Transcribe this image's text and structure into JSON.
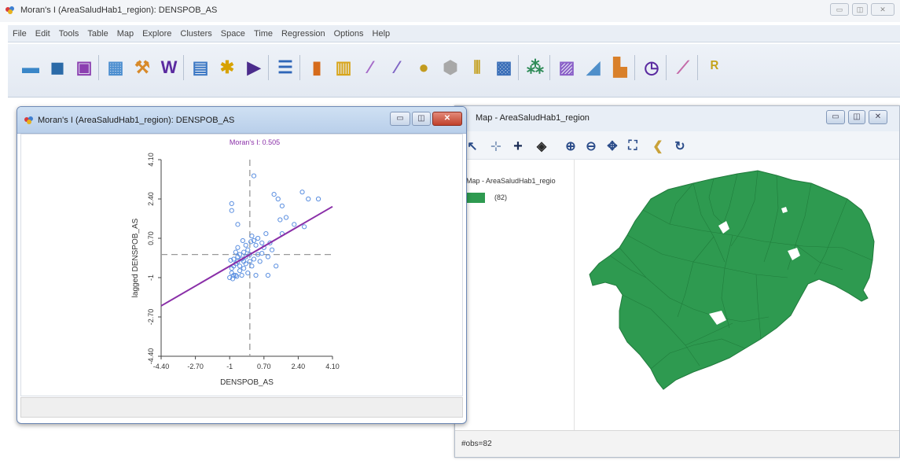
{
  "app": {
    "title": "Moran's I (AreaSaludHab1_region): DENSPOB_AS",
    "menu": [
      "File",
      "Edit",
      "Tools",
      "Table",
      "Map",
      "Explore",
      "Clusters",
      "Space",
      "Time",
      "Regression",
      "Options",
      "Help"
    ]
  },
  "toolbar_icons": [
    {
      "name": "open-project-icon",
      "color": "#3a86c8",
      "glyph": "▬"
    },
    {
      "name": "close-project-icon",
      "color": "#2b6aa8",
      "glyph": "◼"
    },
    {
      "name": "save-project-icon",
      "color": "#8b3fb0",
      "glyph": "▣"
    },
    {
      "name": "table-icon",
      "color": "#4d8fd0",
      "glyph": "▦"
    },
    {
      "name": "tools-icon",
      "color": "#d88a2a",
      "glyph": "⚒"
    },
    {
      "name": "weights-icon",
      "color": "#5a2aa0",
      "glyph": "W"
    },
    {
      "name": "shape-icon",
      "color": "#3c78c4",
      "glyph": "▤"
    },
    {
      "name": "connectivity-icon",
      "color": "#d7a200",
      "glyph": "✱"
    },
    {
      "name": "play-icon",
      "color": "#4b2c8c",
      "glyph": "▶"
    },
    {
      "name": "category-editor-icon",
      "color": "#2f66b8",
      "glyph": "☰"
    },
    {
      "name": "histogram-icon",
      "color": "#d66b1c",
      "glyph": "▮"
    },
    {
      "name": "box-plot-icon",
      "color": "#d8a51b",
      "glyph": "▥"
    },
    {
      "name": "scatter-plot-icon",
      "color": "#a569c8",
      "glyph": "⁄"
    },
    {
      "name": "scatter-matrix-icon",
      "color": "#7e64c4",
      "glyph": "⁄"
    },
    {
      "name": "bubble-chart-icon",
      "color": "#c29b1f",
      "glyph": "●"
    },
    {
      "name": "3d-plot-icon",
      "color": "#a8a8a8",
      "glyph": "⬢"
    },
    {
      "name": "parallel-coords-icon",
      "color": "#c6a42a",
      "glyph": "⫴"
    },
    {
      "name": "conditional-plot-icon",
      "color": "#3b6fb8",
      "glyph": "▩"
    },
    {
      "name": "cluster-icon",
      "color": "#2e8b57",
      "glyph": "⁂"
    },
    {
      "name": "moran-scatter-icon",
      "color": "#8a5fc8",
      "glyph": "▨"
    },
    {
      "name": "lisa-icon",
      "color": "#4f8fca",
      "glyph": "◢"
    },
    {
      "name": "cartogram-icon",
      "color": "#d9802a",
      "glyph": "▙"
    },
    {
      "name": "time-icon",
      "color": "#5a2aa0",
      "glyph": "◷"
    },
    {
      "name": "averages-chart-icon",
      "color": "#c46aa8",
      "glyph": "⟋"
    },
    {
      "name": "regression-icon",
      "color": "#c4a31a",
      "glyph": "ᴿ"
    }
  ],
  "map_window": {
    "title": "Map - AreaSaludHab1_region",
    "legend_title": "Map - AreaSaludHab1_regio",
    "legend_count": "(82)",
    "legend_color": "#2e9a50",
    "status": "#obs=82",
    "controls": [
      "▭",
      "◫",
      "✕"
    ]
  },
  "moran_window": {
    "title": "Moran's I (AreaSaludHab1_region): DENSPOB_AS",
    "controls": [
      "▭",
      "◫",
      "✕"
    ]
  },
  "chart_data": {
    "type": "scatter",
    "title": "Moran's I: 0.505",
    "xlabel": "DENSPOB_AS",
    "ylabel": "lagged DENSPOB_AS",
    "xlim": [
      -4.4,
      4.1
    ],
    "ylim": [
      -4.4,
      4.1
    ],
    "xticks": [
      "-4.40",
      "-2.70",
      "-1",
      "0.70",
      "2.40",
      "4.10"
    ],
    "yticks": [
      "-4.40",
      "-2.70",
      "-1",
      "0.70",
      "2.40",
      "4.10"
    ],
    "regression": {
      "slope": 0.505,
      "intercept": 0.0,
      "color": "#8a2fa8"
    },
    "point_color": "#5b8fe0",
    "points": [
      [
        -0.9,
        -0.8
      ],
      [
        -0.8,
        -0.5
      ],
      [
        -0.7,
        -0.9
      ],
      [
        -0.6,
        -0.3
      ],
      [
        -0.5,
        -0.7
      ],
      [
        -0.4,
        -0.2
      ],
      [
        -0.3,
        -0.6
      ],
      [
        -0.2,
        -0.4
      ],
      [
        -0.1,
        -0.8
      ],
      [
        0.0,
        -0.3
      ],
      [
        -0.8,
        -0.2
      ],
      [
        -0.7,
        -0.4
      ],
      [
        -0.6,
        -0.1
      ],
      [
        -0.5,
        -0.5
      ],
      [
        -0.4,
        -0.9
      ],
      [
        -0.3,
        0.1
      ],
      [
        -0.2,
        -0.1
      ],
      [
        -0.1,
        0.2
      ],
      [
        0.0,
        0.0
      ],
      [
        0.1,
        -0.5
      ],
      [
        -0.9,
        -0.6
      ],
      [
        -0.8,
        -0.9
      ],
      [
        -0.5,
        0.0
      ],
      [
        -0.3,
        -0.3
      ],
      [
        0.2,
        -0.2
      ],
      [
        0.3,
        0.4
      ],
      [
        0.4,
        0.0
      ],
      [
        0.5,
        -0.3
      ],
      [
        0.6,
        0.5
      ],
      [
        0.7,
        0.3
      ],
      [
        0.2,
        0.6
      ],
      [
        0.1,
        0.8
      ],
      [
        0.4,
        0.7
      ],
      [
        -0.6,
        0.3
      ],
      [
        -0.7,
        0.1
      ],
      [
        -0.2,
        0.4
      ],
      [
        0.9,
        -0.1
      ],
      [
        1.1,
        0.2
      ],
      [
        1.3,
        -0.5
      ],
      [
        0.8,
        0.9
      ],
      [
        -0.9,
        1.9
      ],
      [
        -0.9,
        2.2
      ],
      [
        -0.6,
        1.3
      ],
      [
        0.2,
        3.4
      ],
      [
        1.2,
        2.6
      ],
      [
        1.4,
        2.4
      ],
      [
        1.6,
        2.1
      ],
      [
        1.8,
        1.6
      ],
      [
        2.2,
        1.3
      ],
      [
        1.6,
        0.9
      ],
      [
        2.6,
        2.7
      ],
      [
        2.9,
        2.4
      ],
      [
        3.4,
        2.4
      ],
      [
        2.7,
        1.2
      ],
      [
        1.5,
        1.5
      ],
      [
        -1.0,
        -1.0
      ],
      [
        -0.85,
        -1.05
      ],
      [
        -0.65,
        -0.95
      ],
      [
        0.3,
        -0.9
      ],
      [
        0.9,
        -0.9
      ],
      [
        -0.95,
        -0.25
      ],
      [
        0.05,
        0.55
      ],
      [
        0.6,
        0.05
      ],
      [
        1.0,
        0.5
      ],
      [
        -0.35,
        0.6
      ]
    ]
  }
}
